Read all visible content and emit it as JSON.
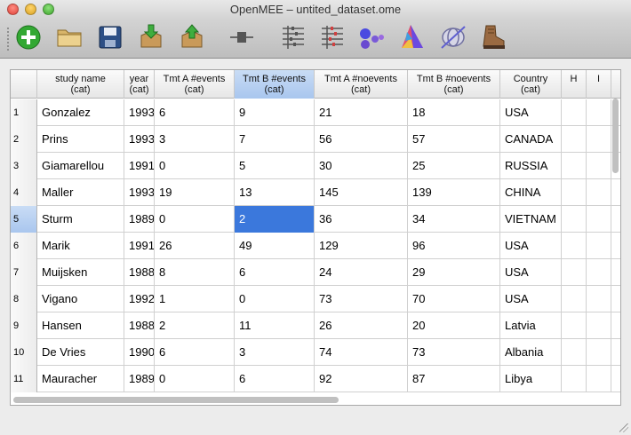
{
  "window": {
    "title": "OpenMEE – untited_dataset.ome"
  },
  "toolbar": {
    "buttons": [
      {
        "name": "add-icon",
        "color": "#2fa82f"
      },
      {
        "name": "open-folder-icon",
        "color": "#c9a24a"
      },
      {
        "name": "save-icon",
        "color": "#2c4f86"
      },
      {
        "name": "import-icon",
        "color": "#b88a4a"
      },
      {
        "name": "export-icon",
        "color": "#b88a4a"
      },
      {
        "name": "transform-icon",
        "color": "#555555"
      },
      {
        "name": "meta-analysis-icon",
        "color": "#555555"
      },
      {
        "name": "forest-plot-icon",
        "color": "#d04040"
      },
      {
        "name": "subgroup-icon",
        "color": "#5050e0"
      },
      {
        "name": "meta-regression-icon",
        "color": "#e05080"
      },
      {
        "name": "model-icon",
        "color": "#7070d0"
      },
      {
        "name": "hiking-boot-icon",
        "color": "#8a5a3a"
      }
    ]
  },
  "table": {
    "columns": [
      {
        "label": "study name",
        "sub": "(cat)"
      },
      {
        "label": "year",
        "sub": "(cat)"
      },
      {
        "label": "Tmt A #events",
        "sub": "(cat)"
      },
      {
        "label": "Tmt B #events",
        "sub": "(cat)"
      },
      {
        "label": "Tmt A #noevents",
        "sub": "(cat)"
      },
      {
        "label": "Tmt B #noevents",
        "sub": "(cat)"
      },
      {
        "label": "Country",
        "sub": "(cat)"
      },
      {
        "label": "H",
        "sub": ""
      },
      {
        "label": "I",
        "sub": ""
      }
    ],
    "selected_column": 3,
    "selected_row": 4,
    "rows": [
      {
        "num": "1",
        "cells": [
          "Gonzalez",
          "1993",
          "6",
          "9",
          "21",
          "18",
          "USA"
        ]
      },
      {
        "num": "2",
        "cells": [
          "Prins",
          "1993",
          "3",
          "7",
          "56",
          "57",
          "CANADA"
        ]
      },
      {
        "num": "3",
        "cells": [
          "Giamarellou",
          "1991",
          "0",
          "5",
          "30",
          "25",
          "RUSSIA"
        ]
      },
      {
        "num": "4",
        "cells": [
          "Maller",
          "1993",
          "19",
          "13",
          "145",
          "139",
          "CHINA"
        ]
      },
      {
        "num": "5",
        "cells": [
          "Sturm",
          "1989",
          "0",
          "2",
          "36",
          "34",
          "VIETNAM"
        ]
      },
      {
        "num": "6",
        "cells": [
          "Marik",
          "1991",
          "26",
          "49",
          "129",
          "96",
          "USA"
        ]
      },
      {
        "num": "7",
        "cells": [
          "Muijsken",
          "1988",
          "8",
          "6",
          "24",
          "29",
          "USA"
        ]
      },
      {
        "num": "8",
        "cells": [
          "Vigano",
          "1992",
          "1",
          "0",
          "73",
          "70",
          "USA"
        ]
      },
      {
        "num": "9",
        "cells": [
          "Hansen",
          "1988",
          "2",
          "11",
          "26",
          "20",
          "Latvia"
        ]
      },
      {
        "num": "10",
        "cells": [
          "De Vries",
          "1990",
          "6",
          "3",
          "74",
          "73",
          "Albania"
        ]
      },
      {
        "num": "11",
        "cells": [
          "Mauracher",
          "1989",
          "0",
          "6",
          "92",
          "87",
          "Libya"
        ]
      }
    ]
  }
}
